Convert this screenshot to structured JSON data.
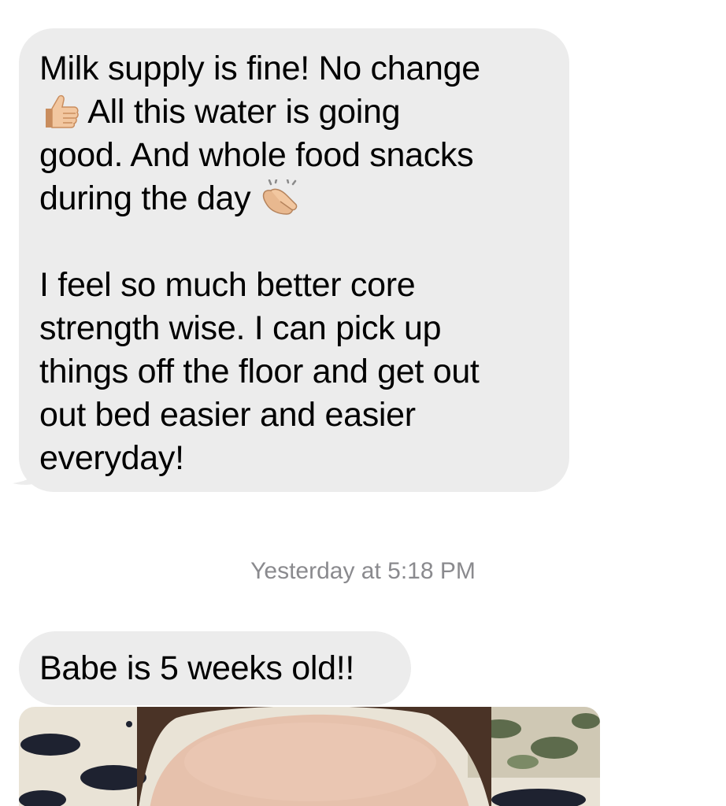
{
  "messages": [
    {
      "sender": "them",
      "lines": [
        "Milk supply is fine! No change",
        "All this water is going",
        "good. And whole food snacks",
        "during the day",
        "I feel so much better core",
        "strength wise. I can pick up",
        "things off the floor and get out",
        "out bed easier and easier",
        "everyday!"
      ],
      "emojis": [
        "thumbs-up-icon",
        "clapping-hands-icon"
      ]
    },
    {
      "sender": "them",
      "text": "Babe is 5 weeks old!!"
    }
  ],
  "timestamp": "Yesterday at 5:18 PM",
  "photo": {
    "description_icon": "baby-photo",
    "colors": {
      "skin": "#d9b09a",
      "hair": "#4a3326",
      "fabric_light": "#e9e3d6",
      "fabric_dark": "#1e2230",
      "plant": "#5d6b4c"
    }
  },
  "colors": {
    "bubble_incoming": "#ececec",
    "timestamp_text": "#8a8a8e",
    "background": "#ffffff"
  }
}
